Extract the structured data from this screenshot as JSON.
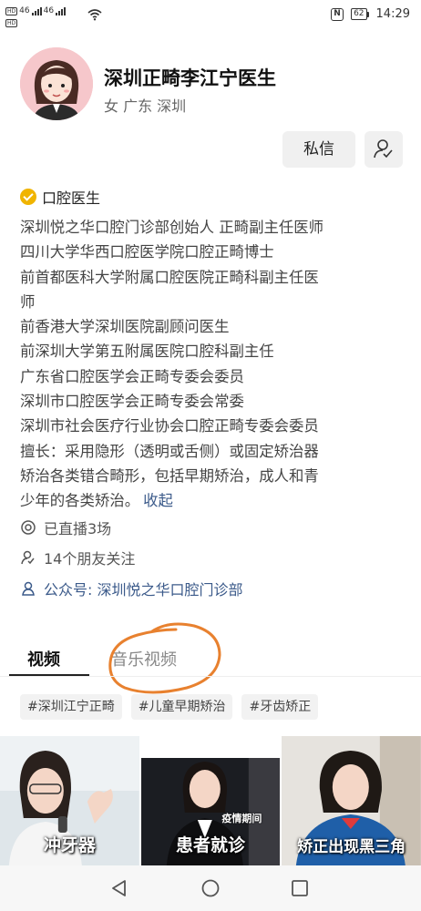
{
  "status_bar": {
    "sim1": "HD",
    "sim1_net": "46",
    "sim2": "HD",
    "sim2_net": "46",
    "nfc": "N",
    "battery": "62",
    "time": "14:29"
  },
  "profile": {
    "name": "深圳正畸李江宁医生",
    "location": "女 广东 深圳",
    "message_button": "私信",
    "add_friend_icon": "person-check-icon",
    "verification": "口腔医生",
    "verification_color": "#f0b400",
    "bio_lines": [
      "深圳悦之华口腔门诊部创始人 正畸副主任医师",
      "四川大学华西口腔医学院口腔正畸博士",
      "前首都医科大学附属口腔医院正畸科副主任医",
      "师",
      "前香港大学深圳医院副顾问医生",
      "前深圳大学第五附属医院口腔科副主任",
      "广东省口腔医学会正畸专委会委员",
      "深圳市口腔医学会正畸专委会常委",
      "深圳市社会医疗行业协会口腔正畸专委会委员",
      "擅长：采用隐形（透明或舌侧）或固定矫治器",
      "矫治各类错合畸形，包括早期矫治，成人和青",
      "少年的各类矫治。"
    ],
    "collapse_label": "收起",
    "live_count": "已直播3场",
    "friends_following": "14个朋友关注",
    "official_account": "公众号: 深圳悦之华口腔门诊部",
    "link_color": "#3b5a8a"
  },
  "tabs": [
    {
      "label": "视频",
      "active": true
    },
    {
      "label": "音乐视频",
      "active": false
    }
  ],
  "annotation_color": "#e8812f",
  "hashtags": [
    "#深圳江宁正畸",
    "#儿童早期矫治",
    "#牙齿矫正"
  ],
  "videos": [
    {
      "caption": "冲牙器",
      "tagline": ""
    },
    {
      "caption": "患者就诊",
      "tagline": "疫情期间"
    },
    {
      "caption": "矫正出现黑三角",
      "tagline": ""
    }
  ],
  "nav": {
    "back": "back-triangle-icon",
    "home": "home-circle-icon",
    "recents": "recents-square-icon"
  }
}
